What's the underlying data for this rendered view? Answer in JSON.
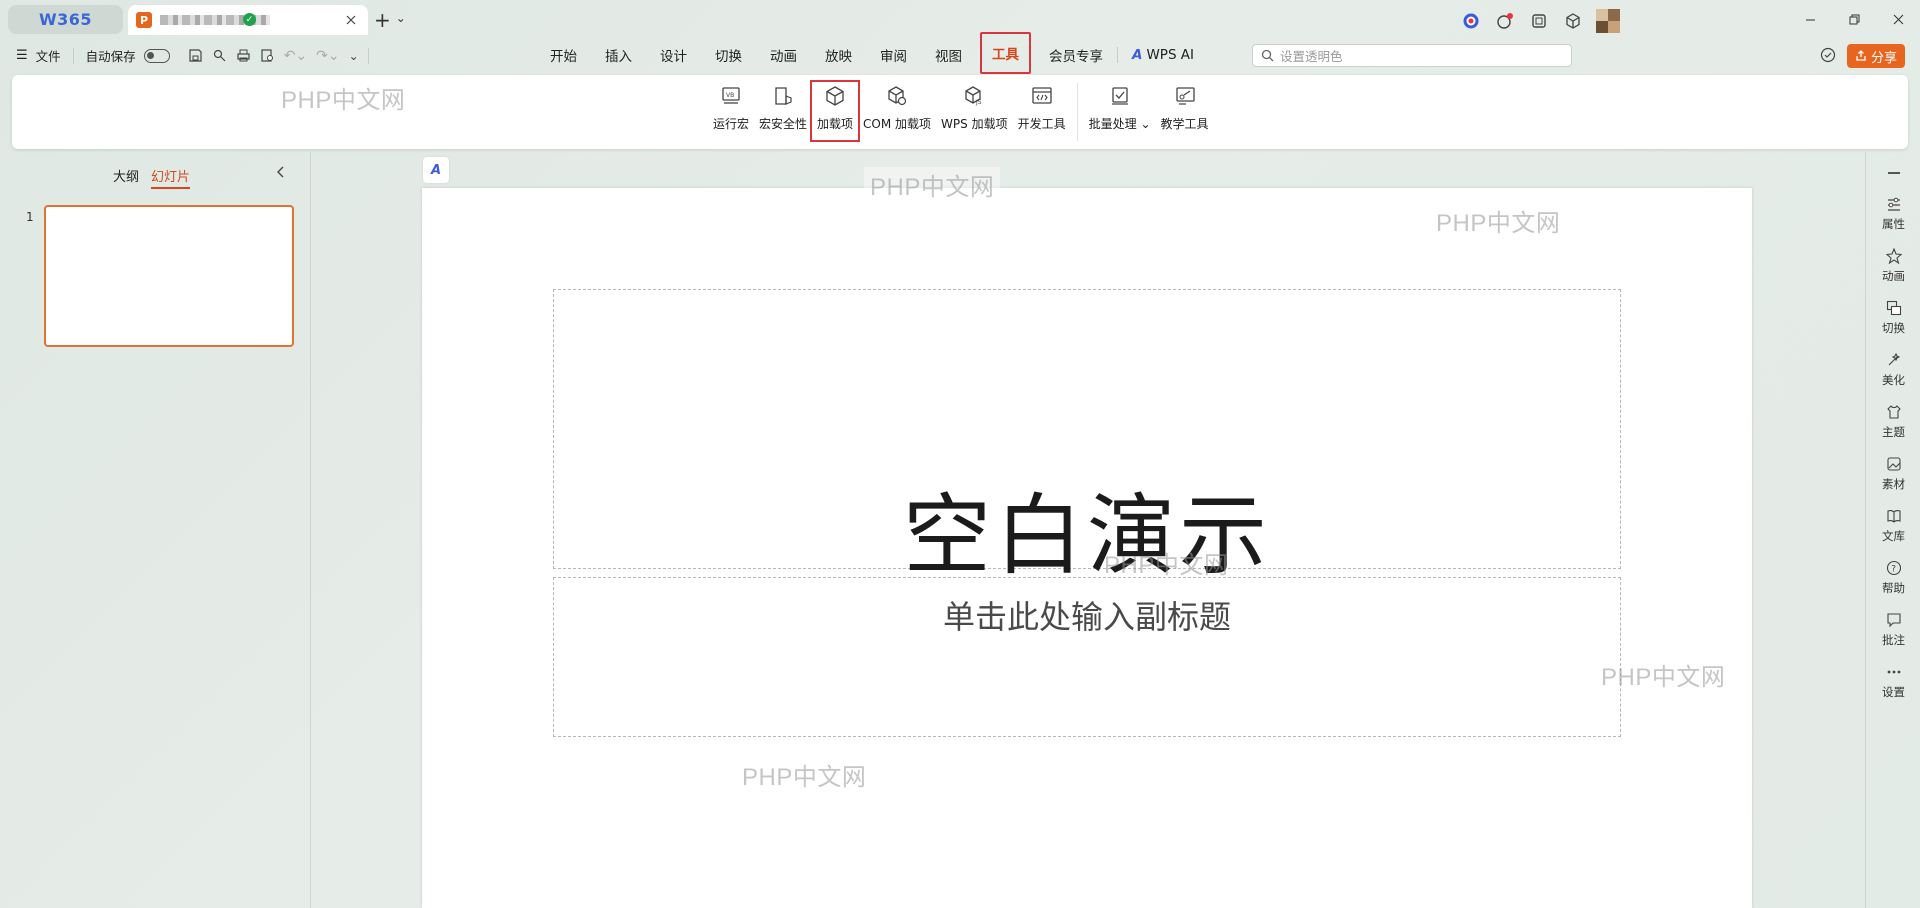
{
  "titlebar": {
    "app_tab": "W365",
    "doc_badge": "P",
    "new_tab": "+",
    "dropdown": "⌄"
  },
  "menubar": {
    "file": "文件",
    "autosave": "自动保存",
    "tabs": [
      "开始",
      "插入",
      "设计",
      "切换",
      "动画",
      "放映",
      "审阅",
      "视图",
      "工具",
      "会员专享",
      "WPS AI"
    ],
    "active_tab": "工具",
    "ai_logo": "A",
    "search_placeholder": "设置透明色",
    "share": "分享"
  },
  "ribbon": {
    "tools": [
      "运行宏",
      "宏安全性",
      "加载项",
      "COM 加载项",
      "WPS 加载项",
      "开发工具",
      "批量处理",
      "教学工具"
    ],
    "highlighted": "加载项"
  },
  "left_panel": {
    "tab_outline": "大纲",
    "tab_slides": "幻灯片",
    "slide_number": "1"
  },
  "slide": {
    "title": "空白演示",
    "subtitle": "单击此处输入副标题"
  },
  "right_sidebar": [
    "属性",
    "动画",
    "切换",
    "美化",
    "主题",
    "素材",
    "文库",
    "帮助",
    "批注",
    "设置"
  ],
  "watermark": "PHP中文网",
  "colors": {
    "accent": "#d4481c",
    "highlight_box": "#d7373c",
    "share_button": "#e8651f",
    "app_blue": "#3a67d8"
  }
}
